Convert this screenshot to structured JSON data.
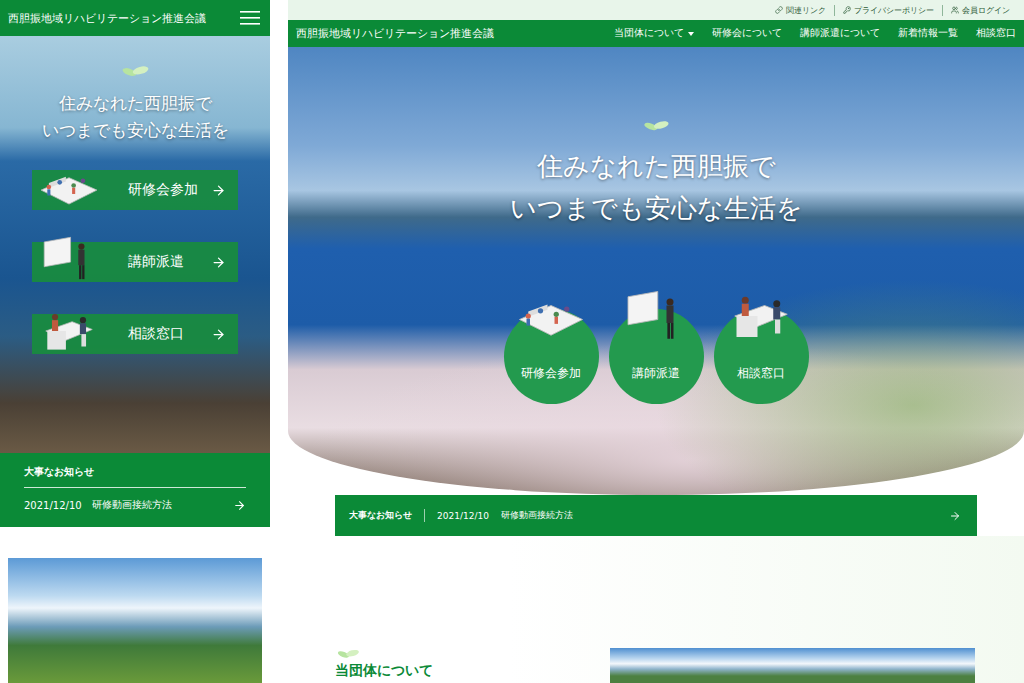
{
  "mobile": {
    "header": {
      "title": "西胆振地域リハビリテーション推進会議"
    },
    "hero": {
      "heading": [
        "住みなれた西胆振で",
        "いつまでも安心な生活を"
      ]
    },
    "buttons": [
      {
        "label": "研修会参加",
        "kind": "seminar"
      },
      {
        "label": "講師派遣",
        "kind": "lecture"
      },
      {
        "label": "相談窓口",
        "kind": "consult"
      }
    ],
    "notice": {
      "title": "大事なお知らせ",
      "date": "2021/12/10",
      "text": "研修動画接続方法"
    }
  },
  "desktop": {
    "utility_links": [
      "関連リンク",
      "プライバシーポリシー",
      "会員ログイン"
    ],
    "header": {
      "title": "西胆振地域リハビリテーション推進会議"
    },
    "nav": [
      {
        "label": "当団体について",
        "dropdown": true
      },
      {
        "label": "研修会について",
        "dropdown": false
      },
      {
        "label": "講師派遣について",
        "dropdown": false
      },
      {
        "label": "新着情報一覧",
        "dropdown": false
      },
      {
        "label": "相談窓口",
        "dropdown": false
      }
    ],
    "hero": {
      "heading": [
        "住みなれた西胆振で",
        "いつまでも安心な生活を"
      ]
    },
    "circles": [
      {
        "label": "研修会参加",
        "kind": "seminar"
      },
      {
        "label": "講師派遣",
        "kind": "lecture"
      },
      {
        "label": "相談窓口",
        "kind": "consult"
      }
    ],
    "notice": {
      "title": "大事なお知らせ",
      "date": "2021/12/10",
      "text": "研修動画接続方法"
    },
    "section": {
      "title": "当団体について"
    }
  }
}
